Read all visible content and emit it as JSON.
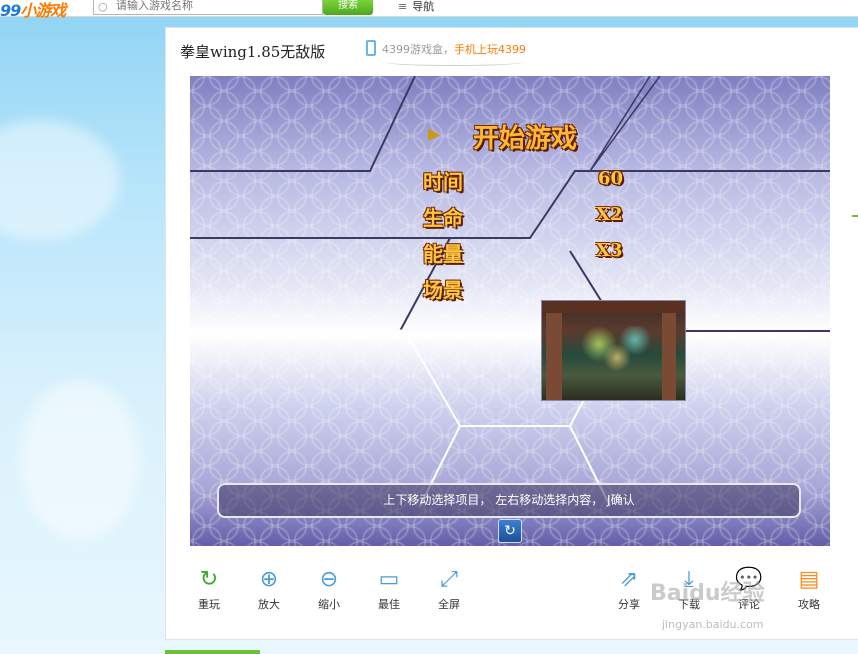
{
  "topbar": {
    "logo_prefix": "99",
    "logo_suffix": "小游戏",
    "search_placeholder": "请输入游戏名称",
    "search_button": "搜索",
    "nav_label": "导航"
  },
  "game": {
    "title": "拳皇wing1.85无敌版",
    "promo_prefix": "4399游戏盒，",
    "promo_link": "手机上玩4399",
    "menu": {
      "start": "开始游戏",
      "items": [
        {
          "label": "时间",
          "value": "60"
        },
        {
          "label": "生命",
          "value": "X2"
        },
        {
          "label": "能量",
          "value": "X3"
        },
        {
          "label": "场景",
          "value": ""
        }
      ]
    },
    "hint": "上下移动选择项目，  左右移动选择内容，  J确认"
  },
  "toolbar": {
    "left": [
      {
        "label": "重玩",
        "icon": "refresh-icon",
        "glyph": "↻"
      },
      {
        "label": "放大",
        "icon": "zoom-in-icon",
        "glyph": "⊕"
      },
      {
        "label": "缩小",
        "icon": "zoom-out-icon",
        "glyph": "⊖"
      },
      {
        "label": "最佳",
        "icon": "window-icon",
        "glyph": "▭"
      },
      {
        "label": "全屏",
        "icon": "fullscreen-icon",
        "glyph": "⤢"
      }
    ],
    "right": [
      {
        "label": "分享",
        "icon": "share-icon",
        "glyph": "⇗"
      },
      {
        "label": "下载",
        "icon": "download-icon",
        "glyph": "⤓"
      },
      {
        "label": "评论",
        "icon": "comment-icon",
        "glyph": "💬"
      },
      {
        "label": "攻略",
        "icon": "guide-icon",
        "glyph": "▤"
      }
    ]
  },
  "watermark": {
    "main": "Baidu经验",
    "sub": "jingyan.baidu.com"
  },
  "colors": {
    "accent_green": "#6ac23a",
    "accent_orange": "#ff7a00",
    "icon_blue": "#4a9bd8"
  }
}
